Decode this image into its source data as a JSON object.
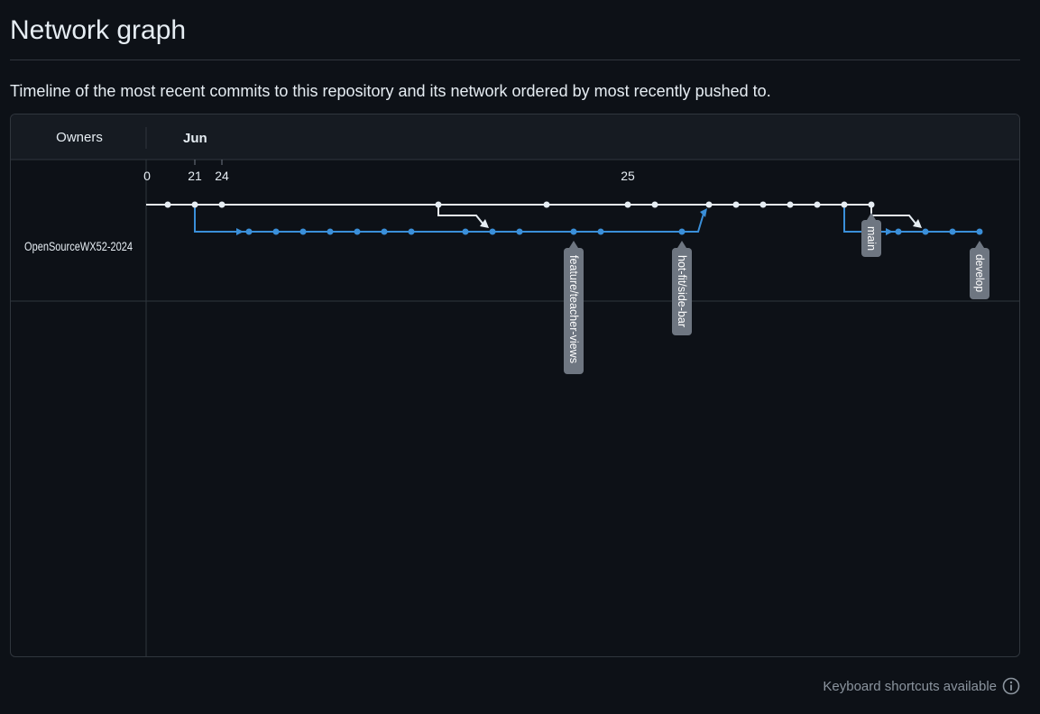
{
  "header": {
    "title": "Network graph",
    "description": "Timeline of the most recent commits to this repository and its network ordered by most recently pushed to."
  },
  "graph": {
    "owners_label": "Owners",
    "month_label": "Jun",
    "day_labels": [
      "0",
      "21",
      "24",
      "25"
    ],
    "owner": "OpenSourceWX52-2024",
    "branches": [
      "feature/teacher-views",
      "hot-fit/side-bar",
      "main",
      "develop"
    ],
    "colors": {
      "main_line": "#e6edf3",
      "branch_line": "#3a8fd9",
      "label_bg": "#6e7681",
      "panel_header": "#161b22",
      "border": "#30363d"
    }
  },
  "footer": {
    "shortcuts_label": "Keyboard shortcuts available",
    "shortcuts_icon": "info-icon"
  }
}
